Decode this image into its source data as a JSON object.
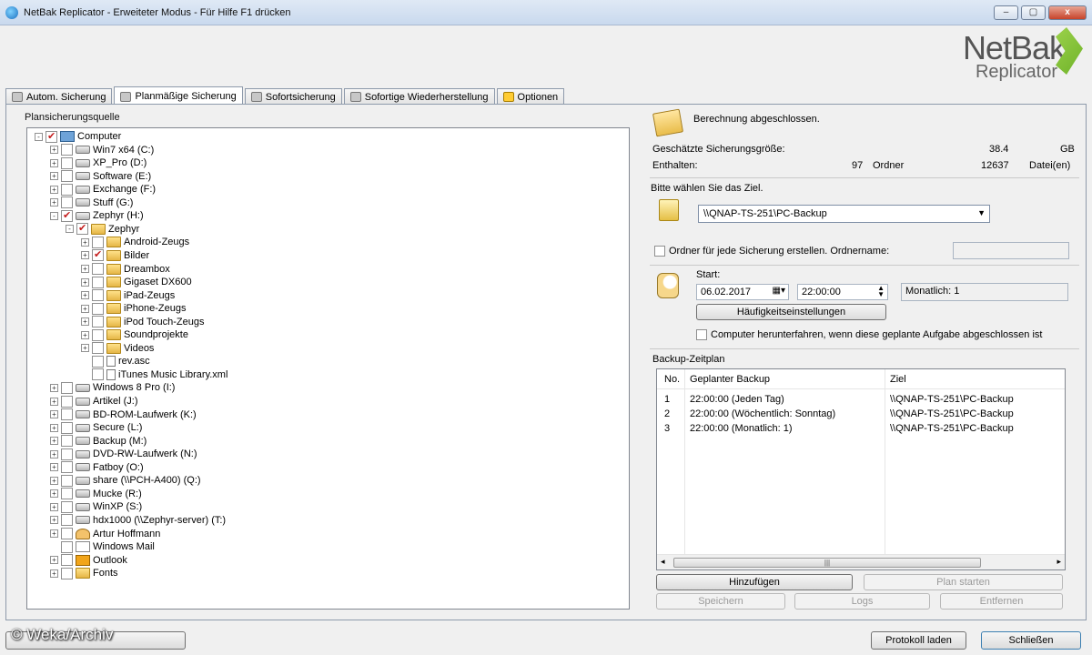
{
  "window": {
    "title": "NetBak Replicator - Erweiteter Modus -  Für Hilfe F1 drücken",
    "logo_top": "NetBak",
    "logo_bottom": "Replicator",
    "btn_min": "–",
    "btn_max": "▢",
    "btn_close": "x"
  },
  "tabs": [
    {
      "label": "Autom. Sicherung",
      "active": false
    },
    {
      "label": "Planmäßige Sicherung",
      "active": true
    },
    {
      "label": "Sofortsicherung",
      "active": false
    },
    {
      "label": "Sofortige Wiederherstellung",
      "active": false
    },
    {
      "label": "Optionen",
      "active": false
    }
  ],
  "source": {
    "label": "Plansicherungsquelle",
    "tree": [
      {
        "label": "Computer",
        "checked": true,
        "icon": "computer-icon",
        "expand": "-"
      },
      {
        "label": "Win7 x64 (C:)",
        "checked": false,
        "icon": "drive-icon",
        "expand": "+"
      },
      {
        "label": "XP_Pro (D:)",
        "checked": false,
        "icon": "drive-icon",
        "expand": "+"
      },
      {
        "label": "Software (E:)",
        "checked": false,
        "icon": "drive-icon",
        "expand": "+"
      },
      {
        "label": "Exchange (F:)",
        "checked": false,
        "icon": "drive-icon",
        "expand": "+"
      },
      {
        "label": "Stuff (G:)",
        "checked": false,
        "icon": "drive-icon",
        "expand": "+"
      },
      {
        "label": "Zephyr (H:)",
        "checked": true,
        "icon": "drive-icon",
        "expand": "-"
      },
      {
        "label": "Zephyr",
        "checked": true,
        "icon": "folder-icon",
        "expand": "-"
      },
      {
        "label": "Android-Zeugs",
        "checked": false,
        "icon": "folder-icon",
        "expand": "+"
      },
      {
        "label": "Bilder",
        "checked": true,
        "icon": "folder-icon",
        "expand": "+"
      },
      {
        "label": "Dreambox",
        "checked": false,
        "icon": "folder-icon",
        "expand": "+"
      },
      {
        "label": "Gigaset DX600",
        "checked": false,
        "icon": "folder-icon",
        "expand": "+"
      },
      {
        "label": "iPad-Zeugs",
        "checked": false,
        "icon": "folder-icon",
        "expand": "+"
      },
      {
        "label": "iPhone-Zeugs",
        "checked": false,
        "icon": "folder-icon",
        "expand": "+"
      },
      {
        "label": "iPod Touch-Zeugs",
        "checked": false,
        "icon": "folder-icon",
        "expand": "+"
      },
      {
        "label": "Soundprojekte",
        "checked": false,
        "icon": "folder-icon",
        "expand": "+"
      },
      {
        "label": "Videos",
        "checked": false,
        "icon": "folder-icon",
        "expand": "+"
      },
      {
        "label": "rev.asc",
        "checked": false,
        "icon": "file-icon",
        "expand": ""
      },
      {
        "label": "iTunes Music Library.xml",
        "checked": false,
        "icon": "file-icon",
        "expand": ""
      },
      {
        "label": "Windows 8 Pro (I:)",
        "checked": false,
        "icon": "drive-icon",
        "expand": "+"
      },
      {
        "label": "Artikel (J:)",
        "checked": false,
        "icon": "drive-icon",
        "expand": "+"
      },
      {
        "label": "BD-ROM-Laufwerk (K:)",
        "checked": false,
        "icon": "drive-icon",
        "expand": "+"
      },
      {
        "label": "Secure (L:)",
        "checked": false,
        "icon": "drive-icon",
        "expand": "+"
      },
      {
        "label": "Backup (M:)",
        "checked": false,
        "icon": "drive-icon",
        "expand": "+"
      },
      {
        "label": "DVD-RW-Laufwerk (N:)",
        "checked": false,
        "icon": "drive-icon",
        "expand": "+"
      },
      {
        "label": "Fatboy (O:)",
        "checked": false,
        "icon": "drive-icon",
        "expand": "+"
      },
      {
        "label": "share (\\\\PCH-A400) (Q:)",
        "checked": false,
        "icon": "drive-icon",
        "expand": "+"
      },
      {
        "label": "Mucke (R:)",
        "checked": false,
        "icon": "drive-icon",
        "expand": "+"
      },
      {
        "label": "WinXP (S:)",
        "checked": false,
        "icon": "drive-icon",
        "expand": "+"
      },
      {
        "label": "hdx1000 (\\\\Zephyr-server) (T:)",
        "checked": false,
        "icon": "drive-icon",
        "expand": "+"
      },
      {
        "label": "Artur Hoffmann",
        "checked": false,
        "icon": "person-icon",
        "expand": "+"
      },
      {
        "label": "Windows Mail",
        "checked": false,
        "icon": "mail-icon",
        "expand": ""
      },
      {
        "label": "Outlook",
        "checked": false,
        "icon": "outlook-icon",
        "expand": "+"
      },
      {
        "label": "Fonts",
        "checked": false,
        "icon": "folder-icon",
        "expand": "+"
      }
    ]
  },
  "status": {
    "message": "Berechnung abgeschlossen.",
    "size_label": "Geschätzte Sicherungsgröße:",
    "size_value": "38.4",
    "size_unit": "GB",
    "contains_label": "Enthalten:",
    "folders_value": "97",
    "folders_label": "Ordner",
    "files_value": "12637",
    "files_label": "Datei(en)"
  },
  "destination": {
    "prompt": "Bitte wählen Sie das Ziel.",
    "selected": "\\\\QNAP-TS-251\\PC-Backup",
    "folder_checkbox_label": "Ordner für jede Sicherung erstellen. Ordnername:",
    "folder_name": ""
  },
  "schedule": {
    "start_label": "Start:",
    "date": "06.02.2017",
    "time": "22:00:00",
    "frequency_text": "Monatlich: 1",
    "frequency_button": "Häufigkeitseinstellungen",
    "shutdown_label": "Computer herunterfahren, wenn diese geplante Aufgabe abgeschlossen ist"
  },
  "plan": {
    "label": "Backup-Zeitplan",
    "columns": [
      "No.",
      "Geplanter Backup",
      "Ziel"
    ],
    "rows": [
      {
        "no": "1",
        "plan": "22:00:00 (Jeden Tag)",
        "target": "\\\\QNAP-TS-251\\PC-Backup"
      },
      {
        "no": "2",
        "plan": "22:00:00 (Wöchentlich: Sonntag)",
        "target": "\\\\QNAP-TS-251\\PC-Backup"
      },
      {
        "no": "3",
        "plan": "22:00:00 (Monatlich: 1)",
        "target": "\\\\QNAP-TS-251\\PC-Backup"
      }
    ],
    "buttons": {
      "add": "Hinzufügen",
      "start": "Plan starten",
      "save": "Speichern",
      "logs": "Logs",
      "remove": "Entfernen"
    }
  },
  "footer": {
    "watermark": "© Weka/Archiv",
    "load_log": "Protokoll laden",
    "close": "Schließen"
  }
}
